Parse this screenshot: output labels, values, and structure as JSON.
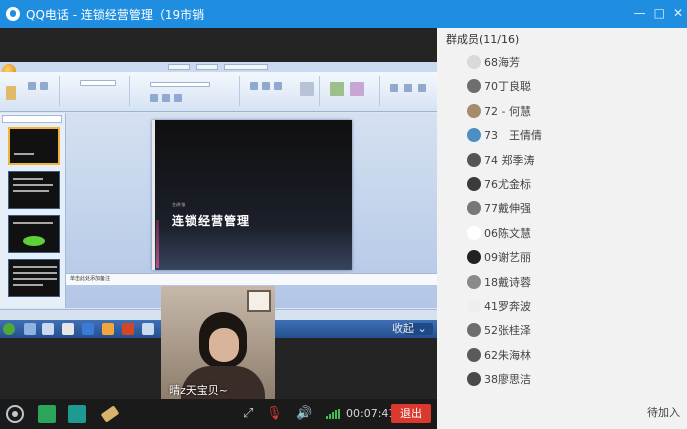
{
  "window": {
    "title": "QQ电话 - 连锁经营管理（19市销",
    "controls": [
      "—",
      "□",
      "✕"
    ]
  },
  "shared_screen": {
    "slide_title": "连锁经营管理",
    "slide_subtitle": "主讲:张",
    "notes_text": "单击此处添加备注"
  },
  "video": {
    "caption": "晴z天宝贝~"
  },
  "collapse": {
    "label": "收起"
  },
  "toolbar": {
    "call_time": "00:07:41",
    "exit_label": "退出"
  },
  "members_panel": {
    "header": "群成员(11/16)",
    "members": [
      {
        "name": "68海芳",
        "avatar_color": "#d9d9d9"
      },
      {
        "name": "70丁良聪",
        "avatar_color": "#6e6e6e"
      },
      {
        "name": "72 - 何慧",
        "avatar_color": "#a58c6b"
      },
      {
        "name": "73　王倩倩",
        "avatar_color": "#4c8fc4"
      },
      {
        "name": "74 郑季涛",
        "avatar_color": "#555555"
      },
      {
        "name": "76尤金标",
        "avatar_color": "#3b3b3b"
      },
      {
        "name": "77戴伸强",
        "avatar_color": "#777777"
      },
      {
        "name": "06陈文慧",
        "avatar_color": "#ffffff"
      },
      {
        "name": "09谢艺丽",
        "avatar_color": "#222222"
      },
      {
        "name": "18戴诗蓉",
        "avatar_color": "#8a8a8a"
      },
      {
        "name": "41罗奔波",
        "avatar_color": "#eeeeee"
      },
      {
        "name": "52张桂泽",
        "avatar_color": "#6d6d6d"
      },
      {
        "name": "62朱海林",
        "avatar_color": "#5a5a5a"
      },
      {
        "name": "38廖思洁",
        "avatar_color": "#4a4a4a"
      }
    ],
    "waiting_label": "待加入"
  }
}
